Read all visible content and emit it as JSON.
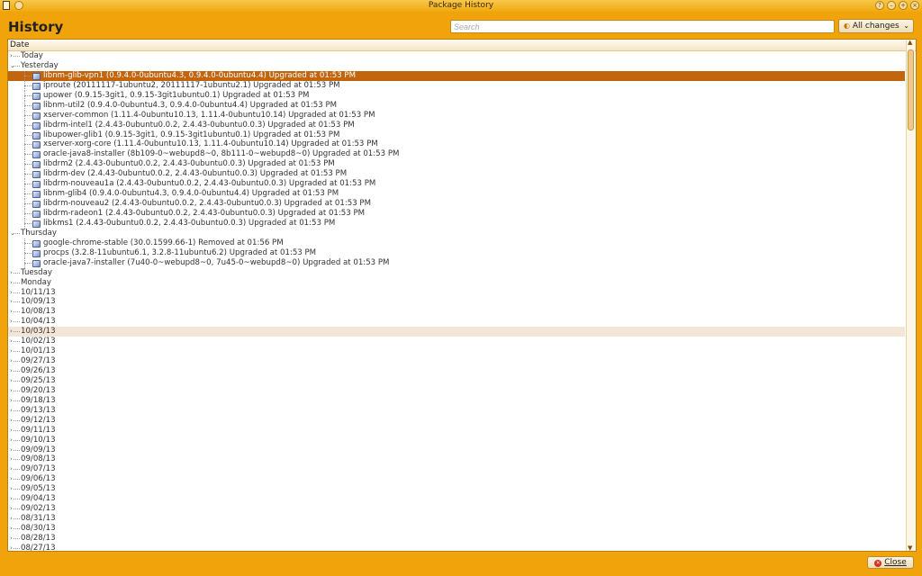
{
  "window": {
    "title": "Package History",
    "controls": [
      "help-icon",
      "minimize-icon",
      "maximize-icon",
      "close-icon"
    ]
  },
  "header": {
    "heading": "History",
    "search_placeholder": "Search",
    "filter_value": "All changes"
  },
  "tree": {
    "column_header": "Date",
    "rows": [
      {
        "type": "group",
        "expanded": false,
        "label": "Today"
      },
      {
        "type": "group",
        "expanded": true,
        "label": "Yesterday"
      },
      {
        "type": "item",
        "selected": true,
        "label": "libnm-glib-vpn1 (0.9.4.0-0ubuntu4.3, 0.9.4.0-0ubuntu4.4) Upgraded at 01:53 PM"
      },
      {
        "type": "item",
        "label": "iproute (20111117-1ubuntu2, 20111117-1ubuntu2.1) Upgraded at 01:53 PM"
      },
      {
        "type": "item",
        "label": "upower (0.9.15-3git1, 0.9.15-3git1ubuntu0.1) Upgraded at 01:53 PM"
      },
      {
        "type": "item",
        "label": "libnm-util2 (0.9.4.0-0ubuntu4.3, 0.9.4.0-0ubuntu4.4) Upgraded at 01:53 PM"
      },
      {
        "type": "item",
        "label": "xserver-common (1.11.4-0ubuntu10.13, 1.11.4-0ubuntu10.14) Upgraded at 01:53 PM"
      },
      {
        "type": "item",
        "label": "libdrm-intel1 (2.4.43-0ubuntu0.0.2, 2.4.43-0ubuntu0.0.3) Upgraded at 01:53 PM"
      },
      {
        "type": "item",
        "label": "libupower-glib1 (0.9.15-3git1, 0.9.15-3git1ubuntu0.1) Upgraded at 01:53 PM"
      },
      {
        "type": "item",
        "label": "xserver-xorg-core (1.11.4-0ubuntu10.13, 1.11.4-0ubuntu10.14) Upgraded at 01:53 PM"
      },
      {
        "type": "item",
        "label": "oracle-java8-installer (8b109-0~webupd8~0, 8b111-0~webupd8~0) Upgraded at 01:53 PM"
      },
      {
        "type": "item",
        "label": "libdrm2 (2.4.43-0ubuntu0.0.2, 2.4.43-0ubuntu0.0.3) Upgraded at 01:53 PM"
      },
      {
        "type": "item",
        "label": "libdrm-dev (2.4.43-0ubuntu0.0.2, 2.4.43-0ubuntu0.0.3) Upgraded at 01:53 PM"
      },
      {
        "type": "item",
        "label": "libdrm-nouveau1a (2.4.43-0ubuntu0.0.2, 2.4.43-0ubuntu0.0.3) Upgraded at 01:53 PM"
      },
      {
        "type": "item",
        "label": "libnm-glib4 (0.9.4.0-0ubuntu4.3, 0.9.4.0-0ubuntu4.4) Upgraded at 01:53 PM"
      },
      {
        "type": "item",
        "label": "libdrm-nouveau2 (2.4.43-0ubuntu0.0.2, 2.4.43-0ubuntu0.0.3) Upgraded at 01:53 PM"
      },
      {
        "type": "item",
        "label": "libdrm-radeon1 (2.4.43-0ubuntu0.0.2, 2.4.43-0ubuntu0.0.3) Upgraded at 01:53 PM"
      },
      {
        "type": "item",
        "label": "libkms1 (2.4.43-0ubuntu0.0.2, 2.4.43-0ubuntu0.0.3) Upgraded at 01:53 PM"
      },
      {
        "type": "group",
        "expanded": true,
        "label": "Thursday"
      },
      {
        "type": "item",
        "label": "google-chrome-stable (30.0.1599.66-1) Removed at 01:56 PM"
      },
      {
        "type": "item",
        "label": "procps (3.2.8-11ubuntu6.1, 3.2.8-11ubuntu6.2) Upgraded at 01:53 PM"
      },
      {
        "type": "item",
        "label": "oracle-java7-installer (7u40-0~webupd8~0, 7u45-0~webupd8~0) Upgraded at 01:53 PM"
      },
      {
        "type": "group",
        "expanded": false,
        "label": "Tuesday"
      },
      {
        "type": "group",
        "expanded": false,
        "label": "Monday"
      },
      {
        "type": "group",
        "expanded": false,
        "label": "10/11/13"
      },
      {
        "type": "group",
        "expanded": false,
        "label": "10/09/13"
      },
      {
        "type": "group",
        "expanded": false,
        "label": "10/08/13"
      },
      {
        "type": "group",
        "expanded": false,
        "label": "10/04/13"
      },
      {
        "type": "group",
        "expanded": false,
        "hover": true,
        "label": "10/03/13"
      },
      {
        "type": "group",
        "expanded": false,
        "label": "10/02/13"
      },
      {
        "type": "group",
        "expanded": false,
        "label": "10/01/13"
      },
      {
        "type": "group",
        "expanded": false,
        "label": "09/27/13"
      },
      {
        "type": "group",
        "expanded": false,
        "label": "09/26/13"
      },
      {
        "type": "group",
        "expanded": false,
        "label": "09/25/13"
      },
      {
        "type": "group",
        "expanded": false,
        "label": "09/20/13"
      },
      {
        "type": "group",
        "expanded": false,
        "label": "09/18/13"
      },
      {
        "type": "group",
        "expanded": false,
        "label": "09/13/13"
      },
      {
        "type": "group",
        "expanded": false,
        "label": "09/12/13"
      },
      {
        "type": "group",
        "expanded": false,
        "label": "09/11/13"
      },
      {
        "type": "group",
        "expanded": false,
        "label": "09/10/13"
      },
      {
        "type": "group",
        "expanded": false,
        "label": "09/09/13"
      },
      {
        "type": "group",
        "expanded": false,
        "label": "09/08/13"
      },
      {
        "type": "group",
        "expanded": false,
        "label": "09/07/13"
      },
      {
        "type": "group",
        "expanded": false,
        "label": "09/06/13"
      },
      {
        "type": "group",
        "expanded": false,
        "label": "09/05/13"
      },
      {
        "type": "group",
        "expanded": false,
        "label": "09/04/13"
      },
      {
        "type": "group",
        "expanded": false,
        "label": "09/02/13"
      },
      {
        "type": "group",
        "expanded": false,
        "label": "08/31/13"
      },
      {
        "type": "group",
        "expanded": false,
        "label": "08/30/13"
      },
      {
        "type": "group",
        "expanded": false,
        "label": "08/28/13"
      },
      {
        "type": "group",
        "expanded": false,
        "label": "08/27/13"
      }
    ]
  },
  "footer": {
    "close_label": "Close"
  },
  "colors": {
    "window_bg": "#f1a30b",
    "selection": "#c2650c",
    "hover_row": "#f4e6d6"
  }
}
